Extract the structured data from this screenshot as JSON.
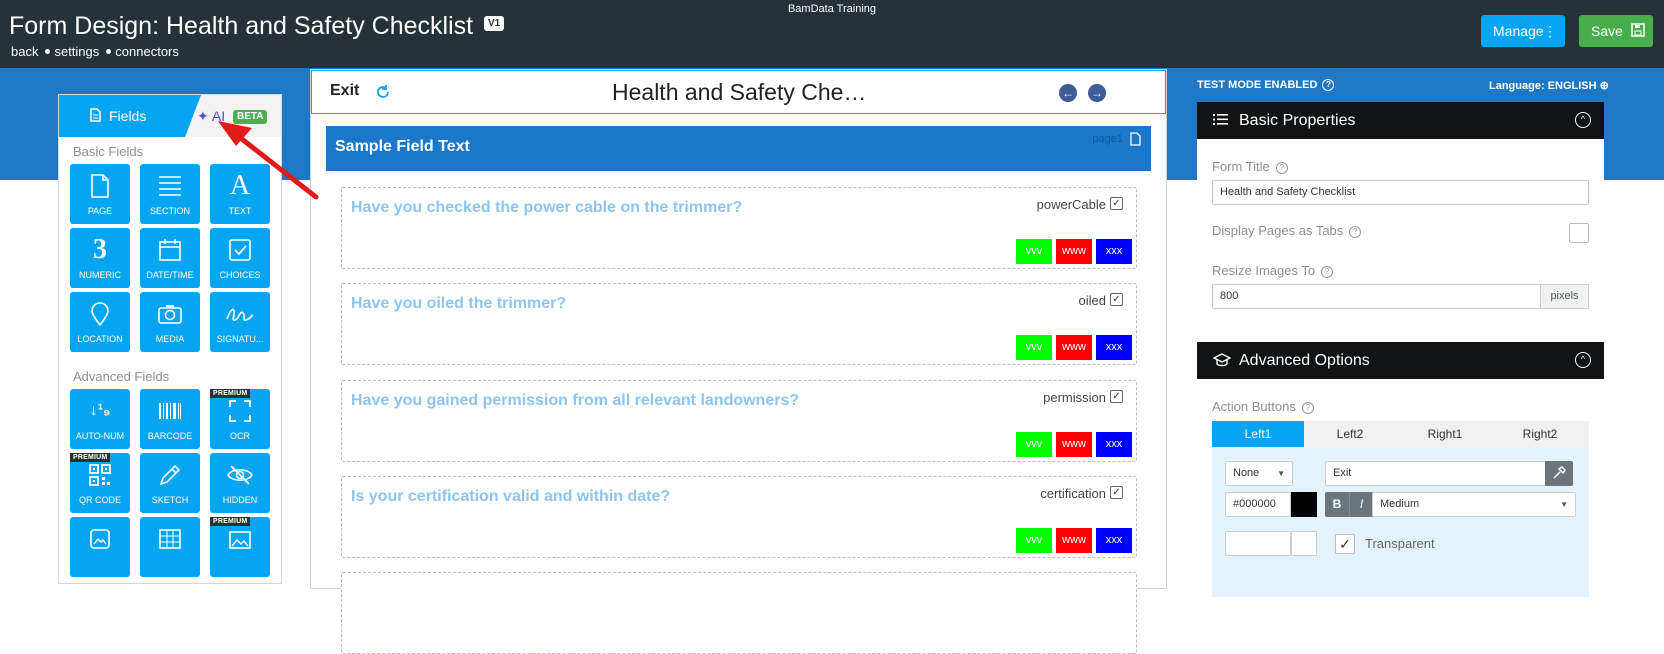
{
  "header": {
    "company": "BamData Training",
    "title": "Form Design: Health and Safety Checklist",
    "version": "V1",
    "nav": [
      "back",
      "settings",
      "connectors"
    ],
    "manage_label": "Manage",
    "save_label": "Save"
  },
  "left_panel": {
    "tab_fields": "Fields",
    "tab_ai": "AI",
    "beta": "BETA",
    "basic_label": "Basic Fields",
    "basic_fields": [
      {
        "label": "PAGE",
        "icon": "page-icon"
      },
      {
        "label": "SECTION",
        "icon": "section-icon"
      },
      {
        "label": "TEXT",
        "icon": "text-icon"
      },
      {
        "label": "NUMERIC",
        "icon": "numeric-icon"
      },
      {
        "label": "DATE/TIME",
        "icon": "calendar-icon"
      },
      {
        "label": "CHOICES",
        "icon": "checkbox-icon"
      },
      {
        "label": "LOCATION",
        "icon": "location-pin-icon"
      },
      {
        "label": "MEDIA",
        "icon": "camera-icon"
      },
      {
        "label": "SIGNATU...",
        "icon": "signature-icon"
      }
    ],
    "advanced_label": "Advanced Fields",
    "advanced_fields": [
      {
        "label": "AUTO-NUM",
        "icon": "auto-number-icon"
      },
      {
        "label": "BARCODE",
        "icon": "barcode-icon"
      },
      {
        "label": "OCR",
        "icon": "ocr-icon",
        "premium": "PREMIUM"
      },
      {
        "label": "QR CODE",
        "icon": "qr-code-icon",
        "premium": "PREMIUM"
      },
      {
        "label": "SKETCH",
        "icon": "pencil-icon"
      },
      {
        "label": "HIDDEN",
        "icon": "hidden-eye-icon"
      }
    ],
    "premium_label": "PREMIUM"
  },
  "form": {
    "exit_label": "Exit",
    "title": "Health and Safety Che…",
    "page_title": "Sample Field Text",
    "page_name": "page1",
    "questions": [
      {
        "text": "Have you checked the power cable on the trimmer?",
        "key": "powerCable"
      },
      {
        "text": "Have you oiled the trimmer?",
        "key": "oiled"
      },
      {
        "text": "Have you gained permission from all relevant landowners?",
        "key": "permission"
      },
      {
        "text": "Is your certification valid and within date?",
        "key": "certification"
      }
    ],
    "options": [
      {
        "label": "vvv",
        "color": "#00ff00"
      },
      {
        "label": "www",
        "color": "#ff0000"
      },
      {
        "label": "xxx",
        "color": "#0000ff"
      }
    ]
  },
  "right_panel": {
    "test_mode": "TEST MODE ENABLED",
    "language": "Language: ENGLISH",
    "basic_header": "Basic Properties",
    "form_title_label": "Form Title",
    "form_title_value": "Health and Safety Checklist",
    "display_tabs_label": "Display Pages as Tabs",
    "resize_label": "Resize Images To",
    "resize_value": "800",
    "resize_unit": "pixels",
    "advanced_header": "Advanced Options",
    "action_buttons_label": "Action Buttons",
    "action_tabs": [
      "Left1",
      "Left2",
      "Right1",
      "Right2"
    ],
    "action_type": "None",
    "action_label": "Exit",
    "color_value": "#000000",
    "bold": "B",
    "italic": "I",
    "size": "Medium",
    "transparent_label": "Transparent"
  }
}
